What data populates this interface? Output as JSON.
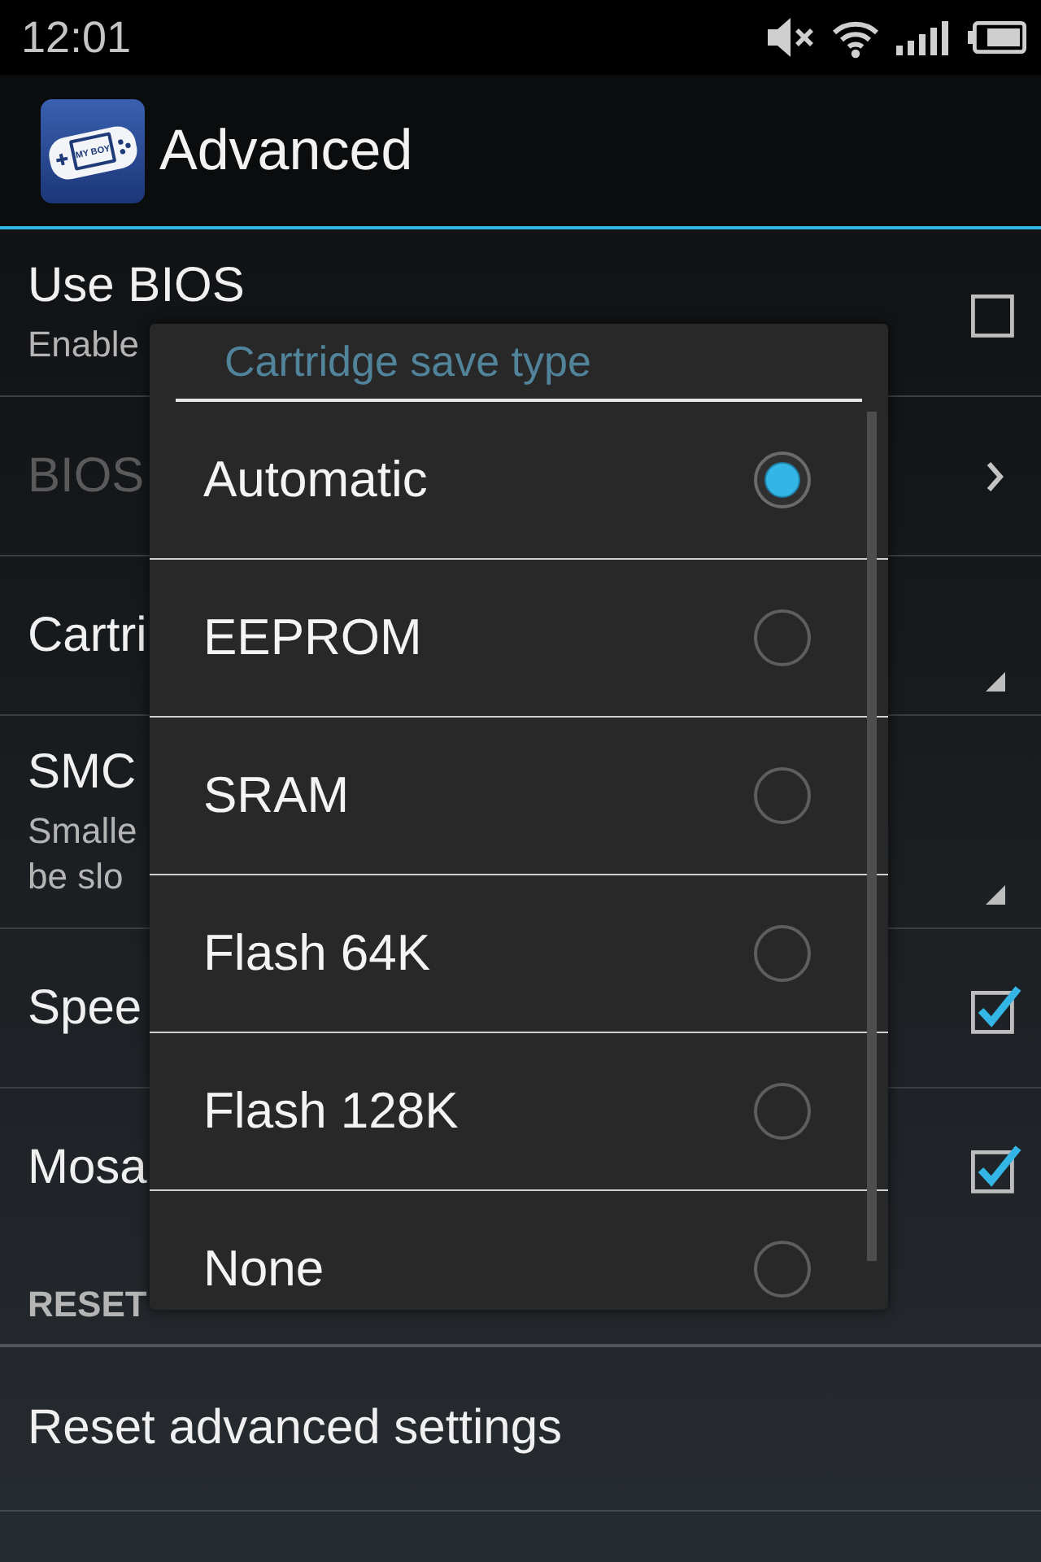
{
  "status_bar": {
    "time": "12:01"
  },
  "action_bar": {
    "title": "Advanced",
    "logo_text": "MY BOY"
  },
  "preferences": [
    {
      "kind": "checkbox",
      "title": "Use BIOS",
      "summary": [
        "Enable"
      ],
      "checked": false,
      "disabled": false
    },
    {
      "kind": "link",
      "title": "BIOS",
      "disabled": true
    },
    {
      "kind": "list",
      "title": "Cartri",
      "disabled": false
    },
    {
      "kind": "list",
      "title": "SMC",
      "summary": [
        "Smalle",
        "be slo"
      ],
      "disabled": false
    },
    {
      "kind": "checkbox",
      "title": "Spee",
      "checked": true,
      "disabled": false
    },
    {
      "kind": "checkbox",
      "title": "Mosa",
      "checked": true,
      "disabled": false
    },
    {
      "kind": "category",
      "title": "RESET",
      "disabled": false
    },
    {
      "kind": "action",
      "title": "Reset advanced settings",
      "disabled": false
    }
  ],
  "dialog": {
    "title": "Cartridge save type",
    "options": [
      {
        "label": "Automatic",
        "selected": true
      },
      {
        "label": "EEPROM",
        "selected": false
      },
      {
        "label": "SRAM",
        "selected": false
      },
      {
        "label": "Flash 64K",
        "selected": false
      },
      {
        "label": "Flash 128K",
        "selected": false
      },
      {
        "label": "None",
        "selected": false
      }
    ]
  }
}
